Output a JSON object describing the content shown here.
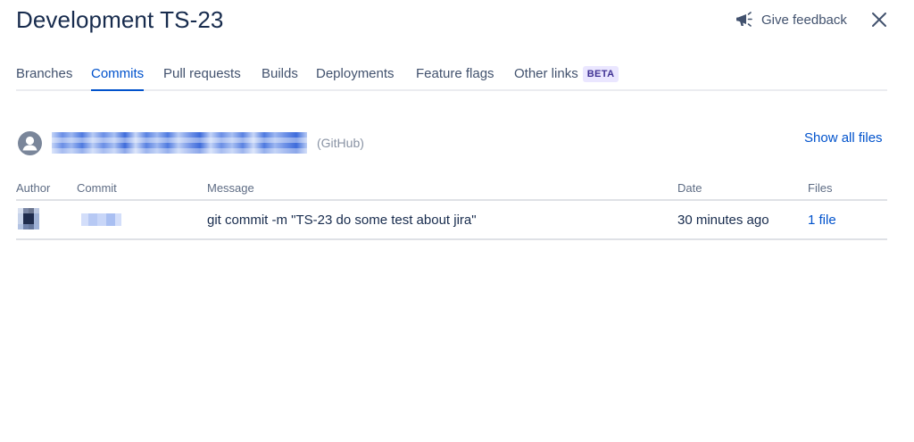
{
  "header": {
    "title": "Development TS-23",
    "feedback_label": "Give feedback"
  },
  "tabs": [
    {
      "label": "Branches",
      "active": false
    },
    {
      "label": "Commits",
      "active": true
    },
    {
      "label": "Pull requests",
      "active": false
    },
    {
      "label": "Builds",
      "active": false
    },
    {
      "label": "Deployments",
      "active": false
    },
    {
      "label": "Feature flags",
      "active": false
    },
    {
      "label": "Other links",
      "active": false,
      "badge": "BETA"
    }
  ],
  "repository": {
    "name": "",
    "provider": "(GitHub)",
    "show_all_files_label": "Show all files"
  },
  "table": {
    "columns": [
      "Author",
      "Commit",
      "Message",
      "Date",
      "Files"
    ],
    "rows": [
      {
        "author": "",
        "commit": "",
        "message": "git commit -m \"TS-23 do some test about jira\"",
        "date": "30 minutes ago",
        "files": "1 file"
      }
    ]
  },
  "icons": {
    "feedback": "megaphone-icon",
    "close": "close-icon",
    "repo_avatar": "user-avatar-icon"
  },
  "colors": {
    "accent": "#0052cc",
    "text": "#172b4d",
    "subtle_text": "#42526e",
    "muted_text": "#5e6c84",
    "beta_bg": "#eae6ff",
    "beta_text": "#403294",
    "divider": "#dfe1e6"
  }
}
